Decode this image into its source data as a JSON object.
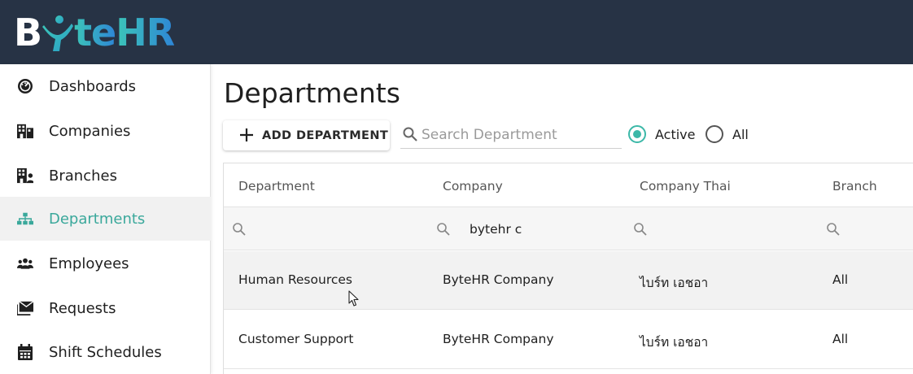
{
  "brand": {
    "logo_prefix": "B",
    "logo_y": "y",
    "logo_te": "te",
    "logo_hr": "HR"
  },
  "sidebar": {
    "items": [
      {
        "label": "Dashboards",
        "icon": "dashboard-icon",
        "active": false
      },
      {
        "label": "Companies",
        "icon": "companies-icon",
        "active": false
      },
      {
        "label": "Branches",
        "icon": "branches-icon",
        "active": false
      },
      {
        "label": "Departments",
        "icon": "departments-icon",
        "active": true
      },
      {
        "label": "Employees",
        "icon": "employees-icon",
        "active": false
      },
      {
        "label": "Requests",
        "icon": "requests-icon",
        "active": false
      },
      {
        "label": "Shift Schedules",
        "icon": "calendar-icon",
        "active": false
      }
    ]
  },
  "main": {
    "title": "Departments",
    "add_button_label": "ADD DEPARTMENT",
    "search": {
      "placeholder": "Search Department",
      "value": ""
    },
    "status_filter": {
      "options": [
        "Active",
        "All"
      ],
      "selected": "Active"
    }
  },
  "table": {
    "columns": [
      "Department",
      "Company",
      "Company Thai",
      "Branch"
    ],
    "filters": [
      "",
      "bytehr c",
      "",
      ""
    ],
    "rows": [
      [
        "Human Resources",
        "ByteHR Company",
        "ไบร์ท เอชอา",
        "All"
      ],
      [
        "Customer Support",
        "ByteHR Company",
        "ไบร์ท เอชอา",
        "All"
      ]
    ]
  },
  "colors": {
    "topbar": "#273345",
    "accent": "#3cb8a8",
    "active_text": "#3aa89b"
  }
}
